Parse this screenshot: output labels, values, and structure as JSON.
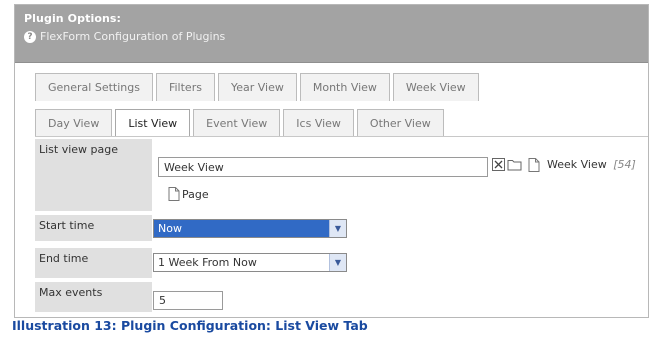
{
  "header": {
    "title": "Plugin Options:",
    "subtitle": "FlexForm Configuration of Plugins"
  },
  "tabs_row1": [
    {
      "label": "General Settings",
      "active": false
    },
    {
      "label": "Filters",
      "active": false
    },
    {
      "label": "Year View",
      "active": false
    },
    {
      "label": "Month View",
      "active": false
    },
    {
      "label": "Week View",
      "active": false
    }
  ],
  "tabs_row2": [
    {
      "label": "Day View",
      "active": false
    },
    {
      "label": "List View",
      "active": true
    },
    {
      "label": "Event View",
      "active": false
    },
    {
      "label": "Ics View",
      "active": false
    },
    {
      "label": "Other View",
      "active": false
    }
  ],
  "form": {
    "list_view_page": {
      "label": "List view page",
      "value": "Week View",
      "page_item_label": "Page",
      "selected_page": "Week View",
      "selected_page_id": "[54]"
    },
    "start_time": {
      "label": "Start time",
      "value": "Now"
    },
    "end_time": {
      "label": "End time",
      "value": "1 Week From Now"
    },
    "max_events": {
      "label": "Max events",
      "value": "5"
    }
  },
  "caption": "Illustration 13: Plugin Configuration: List View Tab",
  "colors": {
    "header_bg": "#a3a3a3",
    "label_bg": "#e0e0e0",
    "highlight": "#316ac5",
    "caption": "#1a4aa0"
  }
}
